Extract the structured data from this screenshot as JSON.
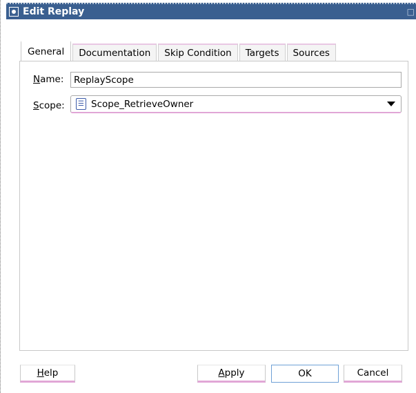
{
  "window": {
    "title": "Edit Replay"
  },
  "tabs": [
    {
      "label": "General",
      "active": true
    },
    {
      "label": "Documentation",
      "active": false
    },
    {
      "label": "Skip Condition",
      "active": false
    },
    {
      "label": "Targets",
      "active": false
    },
    {
      "label": "Sources",
      "active": false
    }
  ],
  "form": {
    "name_label_mnemonic": "N",
    "name_label_rest": "ame:",
    "name_value": "ReplayScope",
    "scope_label_mnemonic": "S",
    "scope_label_rest": "cope:",
    "scope_value": "Scope_RetrieveOwner"
  },
  "buttons": {
    "help_mnemonic": "H",
    "help_rest": "elp",
    "apply_mnemonic": "A",
    "apply_rest": "pply",
    "ok": "OK",
    "cancel": "Cancel"
  },
  "colors": {
    "titlebar": "#3a5f90",
    "accent_underline": "#e1a6d6"
  }
}
